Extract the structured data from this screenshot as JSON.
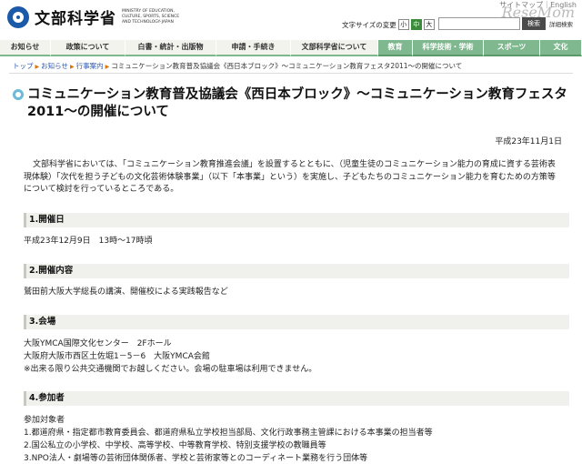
{
  "header": {
    "logo_text": "文部科学省",
    "logo_sub": "MINISTRY OF EDUCATION, CULTURE, SPORTS, SCIENCE AND TECHNOLOGY-JAPAN",
    "top_links": "サイトマップ｜English",
    "watermark": "ReseMom",
    "fontsize_label": "文字サイズの変更",
    "fontsize_small": "小",
    "fontsize_medium": "中",
    "fontsize_large": "大",
    "search_placeholder": "",
    "search_button": "検索",
    "advanced_search": "詳細検索"
  },
  "nav": {
    "items": [
      "お知らせ",
      "政策について",
      "白書・統計・出版物",
      "申請・手続き",
      "文部科学省について",
      "教育",
      "科学技術・学術",
      "スポーツ",
      "文化"
    ]
  },
  "breadcrumb": {
    "home": "トップ",
    "news": "お知らせ",
    "events": "行事案内",
    "current": "コミュニケーション教育普及協議会《西日本ブロック》～コミュニケーション教育フェスタ2011～の開催について"
  },
  "page": {
    "title": "コミュニケーション教育普及協議会《西日本ブロック》～コミュニケーション教育フェスタ2011～の開催について",
    "date": "平成23年11月1日",
    "intro": "文部科学省においては、「コミュニケーション教育推進会議」を設置するとともに、（児童生徒のコミュニケーション能力の育成に資する芸術表現体験）「次代を担う子どもの文化芸術体験事業」（以下「本事業」という）を実施し、子どもたちのコミュニケーション能力を育むための方策等について検討を行っているところである。"
  },
  "sections": [
    {
      "heading": "1.開催日",
      "lines": [
        "平成23年12月9日　13時～17時頃"
      ]
    },
    {
      "heading": "2.開催内容",
      "lines": [
        "鷲田前大阪大学総長の講演、開催校による実践報告など"
      ]
    },
    {
      "heading": "3.会場",
      "lines": [
        "大阪YMCA国際文化センター　2Fホール",
        "大阪府大阪市西区土佐堀1－5－6　大阪YMCA会館",
        "※出来る限り公共交通機関でお越しください。会場の駐車場は利用できません。"
      ]
    },
    {
      "heading": "4.参加者",
      "lines": [
        "参加対象者",
        "1.都道府県・指定都市教育委員会、都道府県私立学校担当部局、文化行政事務主管課における本事業の担当者等",
        "2.国公私立の小学校、中学校、高等学校、中等教育学校、特別支援学校の教職員等",
        "3.NPO法人・劇場等の芸術団体関係者、学校と芸術家等とのコーディネート業務を行う団体等"
      ]
    }
  ]
}
